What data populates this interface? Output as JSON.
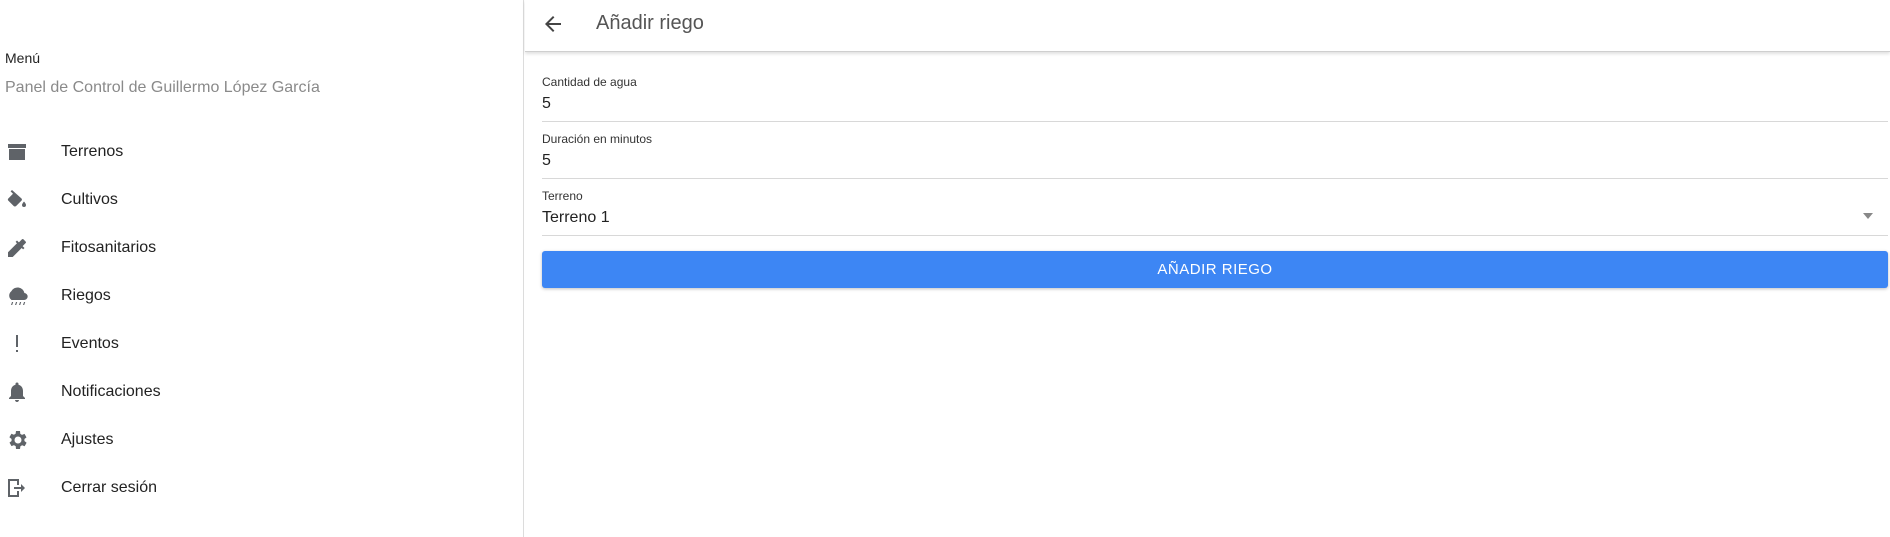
{
  "sidebar": {
    "title": "Menú",
    "subtitle": "Panel de Control de Guillermo López García",
    "items": [
      {
        "label": "Terrenos",
        "icon": "archive-icon"
      },
      {
        "label": "Cultivos",
        "icon": "paint-bucket-icon"
      },
      {
        "label": "Fitosanitarios",
        "icon": "syringe-icon"
      },
      {
        "label": "Riegos",
        "icon": "rain-cloud-icon"
      },
      {
        "label": "Eventos",
        "icon": "exclamation-icon"
      },
      {
        "label": "Notificaciones",
        "icon": "bell-icon"
      },
      {
        "label": "Ajustes",
        "icon": "gear-icon"
      },
      {
        "label": "Cerrar sesión",
        "icon": "logout-icon"
      }
    ]
  },
  "header": {
    "back_icon": "arrow-left-icon",
    "title": "Añadir riego"
  },
  "form": {
    "water": {
      "label": "Cantidad de agua",
      "value": "5"
    },
    "duration": {
      "label": "Duración en minutos",
      "value": "5"
    },
    "terrain": {
      "label": "Terreno",
      "value": "Terreno 1"
    },
    "submit_label": "AÑADIR RIEGO"
  },
  "colors": {
    "accent": "#3d86f4",
    "icon": "#5f6368"
  }
}
